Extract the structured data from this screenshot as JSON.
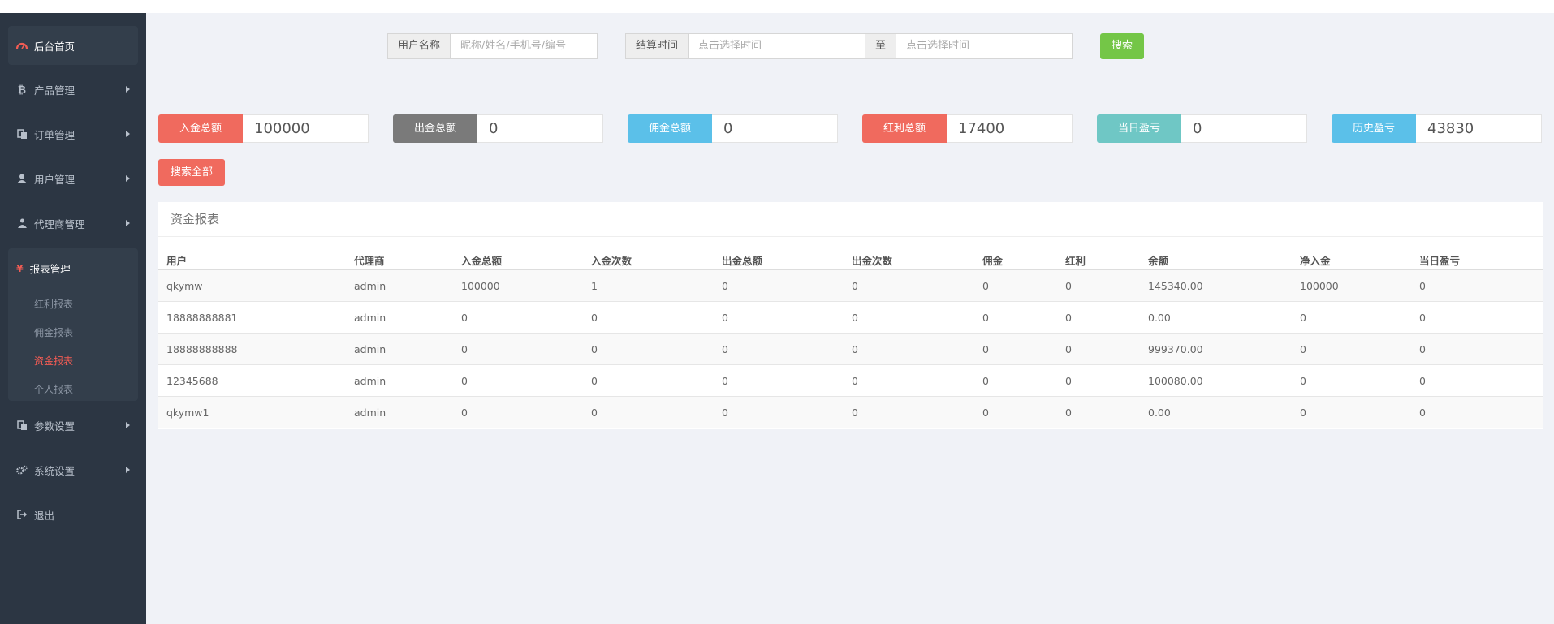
{
  "sidebar": {
    "home": "后台首页",
    "items": [
      {
        "label": "产品管理",
        "icon": "bitcoin-icon"
      },
      {
        "label": "订单管理",
        "icon": "copy-icon"
      },
      {
        "label": "用户管理",
        "icon": "user-icon"
      },
      {
        "label": "代理商管理",
        "icon": "sitemap-icon"
      },
      {
        "label": "报表管理",
        "icon": "yen-icon"
      },
      {
        "label": "参数设置",
        "icon": "copy-icon"
      },
      {
        "label": "系统设置",
        "icon": "gears-icon"
      },
      {
        "label": "退出",
        "icon": "sign-out-icon"
      }
    ],
    "sub_items": [
      "红利报表",
      "佣金报表",
      "资金报表",
      "个人报表"
    ],
    "active_sub": "资金报表"
  },
  "search": {
    "username_label": "用户名称",
    "username_placeholder": "昵称/姓名/手机号/编号",
    "time_label": "结算时间",
    "time_start_placeholder": "点击选择时间",
    "to_label": "至",
    "time_end_placeholder": "点击选择时间",
    "search_button": "搜索",
    "search_all_button": "搜索全部"
  },
  "stats": [
    {
      "label": "入金总额",
      "value": "100000",
      "color": "#f06a5e"
    },
    {
      "label": "出金总额",
      "value": "0",
      "color": "#7a7a7a"
    },
    {
      "label": "佣金总额",
      "value": "0",
      "color": "#5bc0e9"
    },
    {
      "label": "红利总额",
      "value": "17400",
      "color": "#f06a5e"
    },
    {
      "label": "当日盈亏",
      "value": "0",
      "color": "#6fc7c5"
    },
    {
      "label": "历史盈亏",
      "value": "43830",
      "color": "#5bc0e9"
    }
  ],
  "report": {
    "title": "资金报表",
    "columns": [
      "用户",
      "代理商",
      "入金总额",
      "入金次数",
      "出金总额",
      "出金次数",
      "佣金",
      "红利",
      "余额",
      "净入金",
      "当日盈亏"
    ],
    "rows": [
      [
        "qkymw",
        "admin",
        "100000",
        "1",
        "0",
        "0",
        "0",
        "0",
        "145340.00",
        "100000",
        "0"
      ],
      [
        "18888888881",
        "admin",
        "0",
        "0",
        "0",
        "0",
        "0",
        "0",
        "0.00",
        "0",
        "0"
      ],
      [
        "18888888888",
        "admin",
        "0",
        "0",
        "0",
        "0",
        "0",
        "0",
        "999370.00",
        "0",
        "0"
      ],
      [
        "12345688",
        "admin",
        "0",
        "0",
        "0",
        "0",
        "0",
        "0",
        "100080.00",
        "0",
        "0"
      ],
      [
        "qkymw1",
        "admin",
        "0",
        "0",
        "0",
        "0",
        "0",
        "0",
        "0.00",
        "0",
        "0"
      ]
    ]
  }
}
